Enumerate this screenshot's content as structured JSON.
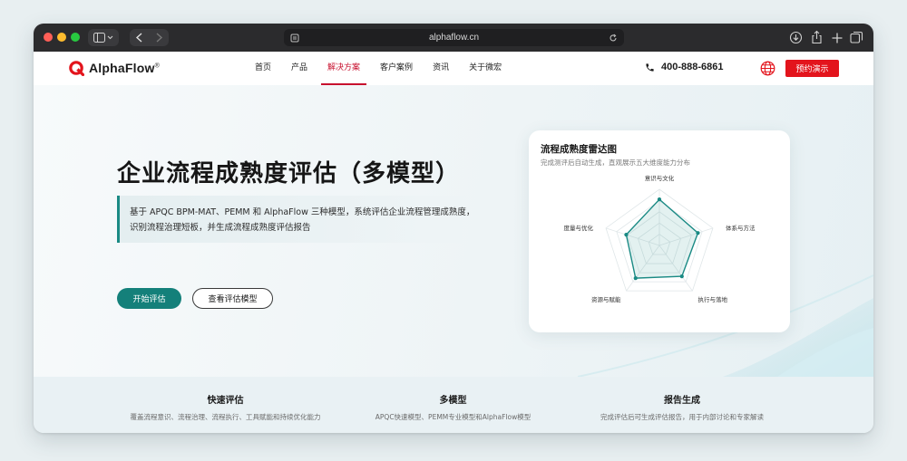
{
  "browser": {
    "url": "alphaflow.cn"
  },
  "nav": {
    "logo_text": "AlphaFlow",
    "logo_mark": "®",
    "menu": [
      {
        "label": "首页"
      },
      {
        "label": "产品"
      },
      {
        "label": "解决方案",
        "active": true
      },
      {
        "label": "客户案例"
      },
      {
        "label": "资讯"
      },
      {
        "label": "关于微宏"
      }
    ],
    "phone": "400-888-6861",
    "demo_button": "预约演示"
  },
  "hero": {
    "title": "企业流程成熟度评估（多模型）",
    "desc_line1": "基于 APQC BPM-MAT、PEMM 和 AlphaFlow 三种模型，系统评估企业流程管理成熟度，",
    "desc_line2": "识别流程治理短板，并生成流程成熟度评估报告",
    "primary_button": "开始评估",
    "secondary_button": "查看评估模型"
  },
  "radar_card": {
    "title": "流程成熟度雷达图",
    "subtitle": "完成测评后自动生成，直观展示五大维度能力分布",
    "axes": [
      "意识与文化",
      "体系与方法",
      "执行与落地",
      "资源与赋能",
      "度量与优化"
    ],
    "values": [
      0.82,
      0.72,
      0.68,
      0.72,
      0.62
    ],
    "accent": "#1a8a84"
  },
  "features": [
    {
      "title": "快速评估",
      "desc": "覆盖流程意识、流程治理、流程执行、工具赋能和持续优化能力"
    },
    {
      "title": "多模型",
      "desc": "APQC快速模型、PEMM专业模型和AlphaFlow模型"
    },
    {
      "title": "报告生成",
      "desc": "完成评估后可生成评估报告，用于内部讨论和专家解读"
    }
  ],
  "colors": {
    "brand_red": "#e3141c",
    "teal": "#14807a"
  }
}
